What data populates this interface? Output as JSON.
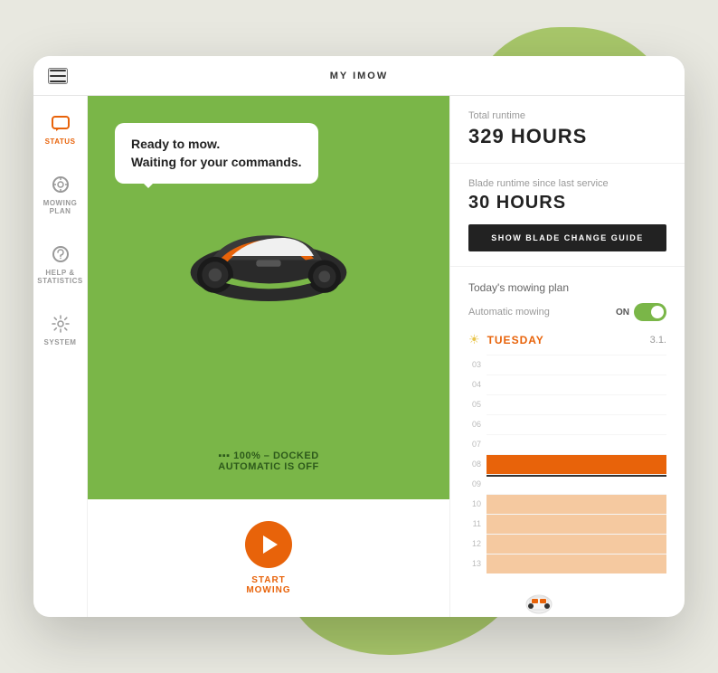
{
  "app": {
    "title": "MY IMOW"
  },
  "sidebar": {
    "items": [
      {
        "id": "status",
        "label": "STATUS",
        "icon": "💬",
        "active": true
      },
      {
        "id": "mowing-plan",
        "label": "MOWING\nPLAN",
        "icon": "⚙",
        "active": false
      },
      {
        "id": "help-statistics",
        "label": "HELP &\nSTATISTICS",
        "icon": "⊕",
        "active": false
      },
      {
        "id": "system",
        "label": "SYSTEM",
        "icon": "⚙",
        "active": false
      }
    ]
  },
  "mower": {
    "message_line1": "Ready to mow.",
    "message_line2": "Waiting for your commands.",
    "battery_percent": "100%",
    "battery_status": "DOCKED",
    "auto_status": "AUTOMATIC IS OFF"
  },
  "runtime": {
    "total_label": "Total runtime",
    "total_value": "329 HOURS",
    "blade_label": "Blade runtime since last service",
    "blade_value": "30 HOURS",
    "blade_btn": "SHOW BLADE CHANGE GUIDE"
  },
  "plan": {
    "label": "Today's mowing plan",
    "auto_mowing_label": "Automatic mowing",
    "toggle_state": "ON",
    "day": "TUESDAY",
    "date": "3.1.",
    "timeline": {
      "hours": [
        "03",
        "04",
        "05",
        "06",
        "07",
        "08",
        "09",
        "10",
        "11",
        "12",
        "13"
      ],
      "active_start": 5,
      "active_end": 6,
      "marker": 6,
      "light_start": 6,
      "light_end": 11
    }
  },
  "start_btn": {
    "label": "START\nMOWING"
  }
}
